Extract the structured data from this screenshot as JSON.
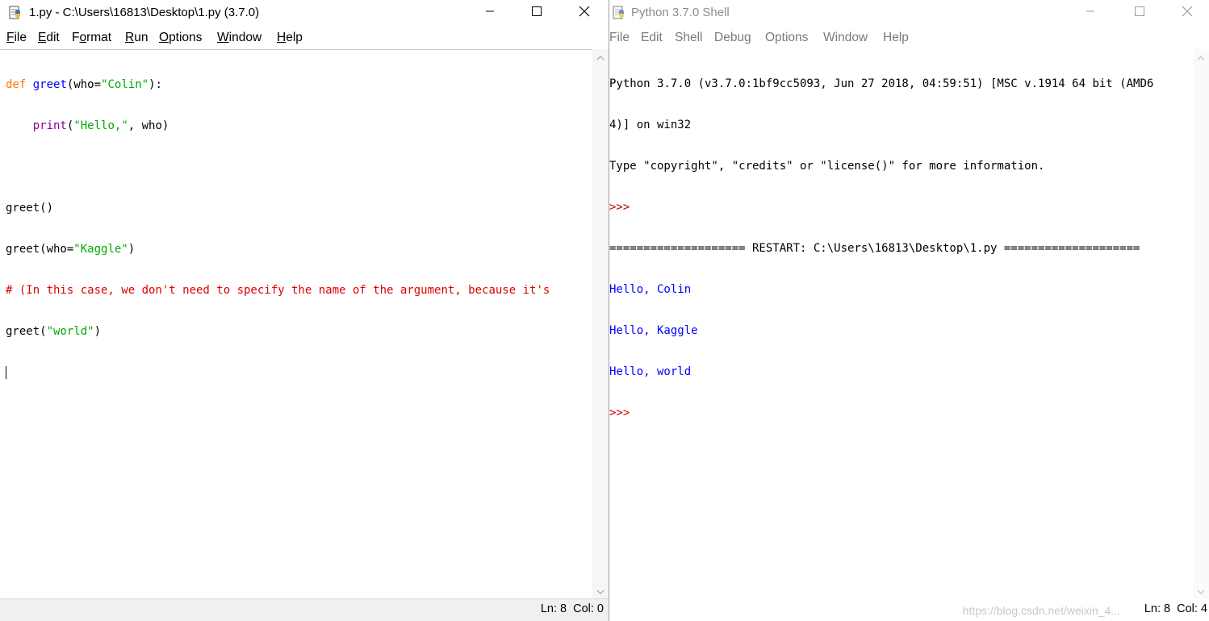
{
  "editor": {
    "title": "1.py - C:\\Users\\16813\\Desktop\\1.py (3.7.0)",
    "menu": [
      {
        "label": "File",
        "u": "F",
        "rest": "ile"
      },
      {
        "label": "Edit",
        "u": "E",
        "rest": "dit"
      },
      {
        "label": "Format",
        "u": "",
        "pre": "F",
        "mid": "o",
        "post": "rmat"
      },
      {
        "label": "Run",
        "u": "R",
        "rest": "un"
      },
      {
        "label": "Options",
        "u": "O",
        "rest": "ptions"
      },
      {
        "label": "Window",
        "u": "W",
        "rest": "indow"
      },
      {
        "label": "Help",
        "u": "H",
        "rest": "elp"
      }
    ],
    "code": {
      "l1_kw": "def",
      "l1_fn": "greet",
      "l1_a": "(who=",
      "l1_str": "\"Colin\"",
      "l1_b": "):",
      "l2_indent": "    ",
      "l2_bi": "print",
      "l2_a": "(",
      "l2_str": "\"Hello,\"",
      "l2_b": ", who)",
      "l4": "greet()",
      "l5_a": "greet(who=",
      "l5_str": "\"Kaggle\"",
      "l5_b": ")",
      "l6_cm": "# (In this case, we don't need to specify the name of the argument, because it's",
      "l7_a": "greet(",
      "l7_str": "\"world\"",
      "l7_b": ")"
    },
    "status": "Ln: 8  Col: 0"
  },
  "shell": {
    "title": "Python 3.7.0 Shell",
    "menu": [
      "File",
      "Edit",
      "Shell",
      "Debug",
      "Options",
      "Window",
      "Help"
    ],
    "lines": {
      "banner1": "Python 3.7.0 (v3.7.0:1bf9cc5093, Jun 27 2018, 04:59:51) [MSC v.1914 64 bit (AMD6",
      "banner2": "4)] on win32",
      "banner3": "Type \"copyright\", \"credits\" or \"license()\" for more information.",
      "prompt": ">>>",
      "restart": "==================== RESTART: C:\\Users\\16813\\Desktop\\1.py ====================",
      "out1": "Hello, Colin",
      "out2": "Hello, Kaggle",
      "out3": "Hello, world"
    },
    "status": "Ln: 8  Col: 4",
    "watermark": "https://blog.csdn.net/weixin_4..."
  },
  "icons": {
    "app": "python-idle-icon",
    "minimize": "minimize-icon",
    "maximize": "maximize-icon",
    "close": "close-icon",
    "scroll_up": "chevron-up-icon",
    "scroll_down": "chevron-down-icon"
  }
}
